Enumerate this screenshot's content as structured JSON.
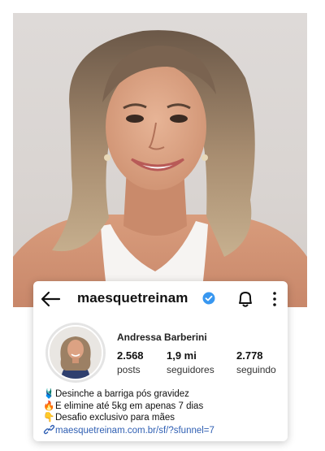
{
  "profile": {
    "username": "maesquetreinam",
    "full_name": "Andressa Barberini",
    "verified": true
  },
  "stats": [
    {
      "value": "2.568",
      "label": "posts"
    },
    {
      "value": "1,9 mi",
      "label": "seguidores"
    },
    {
      "value": "2.778",
      "label": "seguindo"
    }
  ],
  "bio": {
    "lines": [
      {
        "emoji": "🩱",
        "text": "Desinche a barriga pós gravidez"
      },
      {
        "emoji": "🔥",
        "text": "E elimine até 5kg em apenas 7 dias"
      },
      {
        "emoji": "👇",
        "text": "Desafio exclusivo para mães"
      }
    ],
    "link": "maesquetreinam.com.br/sf/?sfunnel=7"
  },
  "icons": {
    "back": "back-arrow-icon",
    "verified": "verified-badge-icon",
    "bell": "bell-icon",
    "more": "more-vertical-icon",
    "link": "link-icon"
  },
  "colors": {
    "verified": "#3897f0",
    "link": "#2f5fb3",
    "background": "#ffffff"
  }
}
